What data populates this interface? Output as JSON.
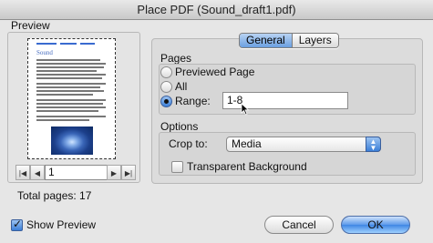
{
  "window": {
    "title": "Place PDF (Sound_draft1.pdf)"
  },
  "preview": {
    "label": "Preview",
    "thumbnail_heading": "Sound",
    "page_field_value": "1",
    "total_pages": "Total pages: 17",
    "show_preview_label": "Show Preview",
    "show_preview_checked": true
  },
  "tabs": [
    {
      "label": "General",
      "selected": true
    },
    {
      "label": "Layers",
      "selected": false
    }
  ],
  "pages": {
    "label": "Pages",
    "options": [
      "Previewed Page",
      "All",
      "Range:"
    ],
    "selected": "Range:",
    "range_value": "1-8"
  },
  "options": {
    "label": "Options",
    "crop_label": "Crop to:",
    "crop_value": "Media",
    "transparent_label": "Transparent Background",
    "transparent_checked": false
  },
  "buttons": {
    "cancel": "Cancel",
    "ok": "OK"
  },
  "colors": {
    "accent": "#3b7fd8",
    "window_bg": "#e6e6e6"
  }
}
